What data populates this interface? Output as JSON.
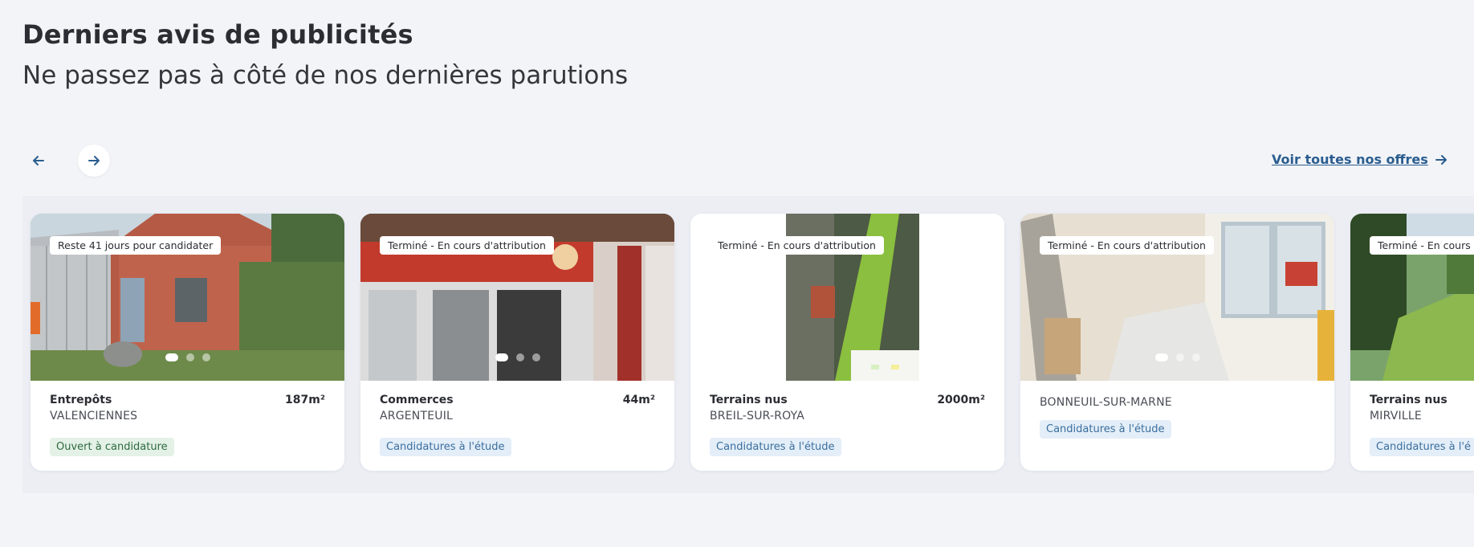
{
  "section": {
    "title": "Derniers avis de publicités",
    "subtitle": "Ne passez pas à côté de nos dernières parutions"
  },
  "nav": {
    "prev_icon": "arrow-left-icon",
    "next_icon": "arrow-right-icon",
    "see_all_label": "Voir toutes nos offres",
    "see_all_icon": "arrow-right-icon"
  },
  "colors": {
    "page_bg": "#f3f4f8",
    "link": "#2a5d8f",
    "open_tag_bg": "#e4f1e7",
    "study_tag_bg": "#e3eef8"
  },
  "cards": [
    {
      "status": "Reste 41 jours pour candidater",
      "category": "Entrepôts",
      "city": "VALENCIENNES",
      "area": "187m²",
      "tag": "Ouvert à candidature",
      "image": "brick-warehouse-photo",
      "carousel_index": 1,
      "carousel_count": 3
    },
    {
      "status": "Terminé - En cours d'attribution",
      "category": "Commerces",
      "city": "ARGENTEUIL",
      "area": "44m²",
      "tag": "Candidatures à l'étude",
      "image": "cafe-storefront-photo",
      "carousel_index": 1,
      "carousel_count": 3
    },
    {
      "status": "Terminé - En cours d'attribution",
      "category": "Terrains nus",
      "city": "BREIL-SUR-ROYA",
      "area": "2000m²",
      "tag": "Candidatures à l'étude",
      "image": "aerial-map-photo"
    },
    {
      "status": "Terminé - En cours d'attribution",
      "category": "",
      "city": "BONNEUIL-SUR-MARNE",
      "area": "",
      "tag": "Candidatures à l'étude",
      "image": "interior-room-photo",
      "carousel_index": 1,
      "carousel_count": 3
    },
    {
      "status": "Terminé - En cours d'a",
      "category": "Terrains nus",
      "city": "MIRVILLE",
      "area": "",
      "tag": "Candidatures à l'é",
      "image": "green-field-photo"
    }
  ]
}
